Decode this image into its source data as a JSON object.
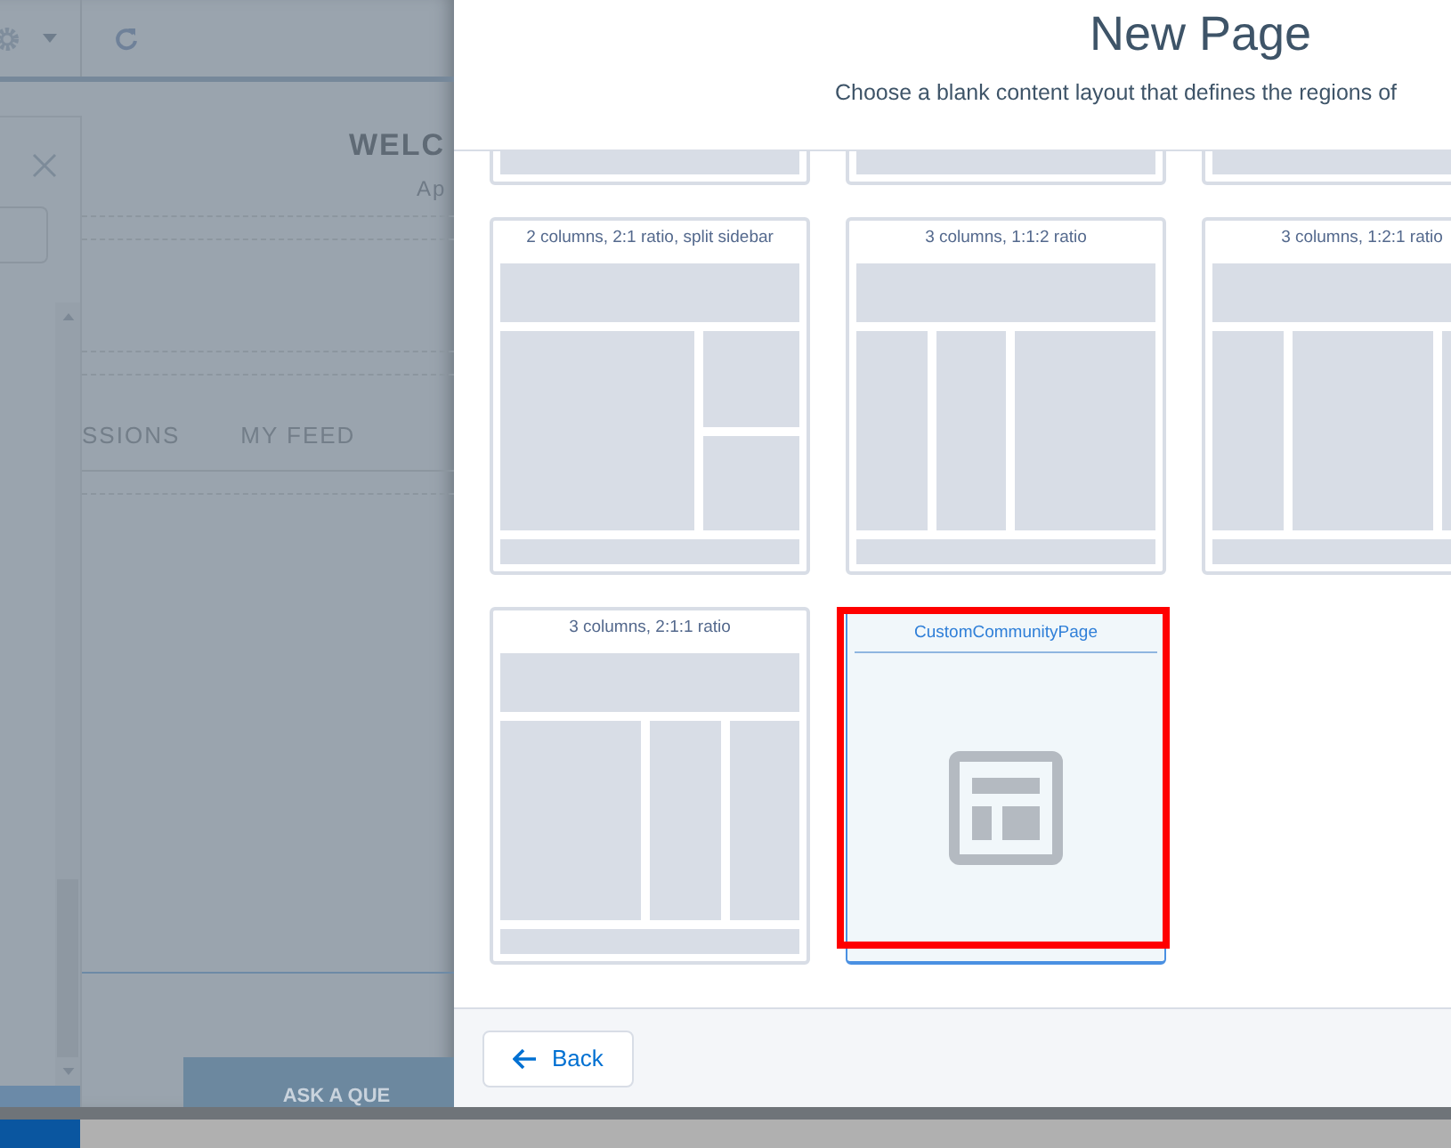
{
  "background_page": {
    "heading": "WELC",
    "subheading": "Ap",
    "tabs": [
      {
        "label": "SSIONS"
      },
      {
        "label": "MY FEED"
      }
    ],
    "ask_button": "ASK A QUE"
  },
  "modal": {
    "title": "New Page",
    "subtitle": "Choose a blank content layout that defines the regions of",
    "layouts": [
      {
        "kind": "partial",
        "selected": false,
        "annotated": false
      },
      {
        "kind": "partial",
        "selected": false,
        "annotated": false
      },
      {
        "kind": "partial",
        "selected": false,
        "annotated": false
      },
      {
        "kind": "sidebar-split",
        "label": "2 columns, 2:1 ratio, split sidebar",
        "selected": false,
        "annotated": false
      },
      {
        "kind": "three-col-112",
        "label": "3 columns, 1:1:2 ratio",
        "selected": false,
        "annotated": false
      },
      {
        "kind": "three-col-121",
        "label": "3 columns, 1:2:1 ratio",
        "selected": false,
        "annotated": false
      },
      {
        "kind": "three-col-211",
        "label": "3 columns, 2:1:1 ratio",
        "selected": false,
        "annotated": false
      },
      {
        "kind": "custom",
        "label": "CustomCommunityPage",
        "selected": true,
        "annotated": true
      }
    ],
    "back_button": "Back"
  }
}
